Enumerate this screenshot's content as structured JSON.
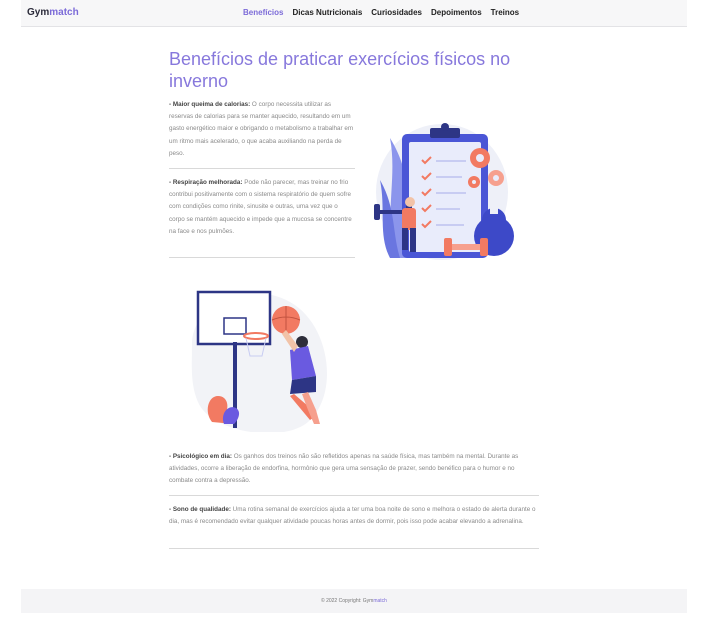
{
  "nav": {
    "brand_prefix": "Gym",
    "brand_suffix": "match",
    "links": [
      "Benefícios",
      "Dicas Nutricionais",
      "Curiosidades",
      "Depoimentos",
      "Treinos"
    ]
  },
  "main": {
    "title": "Benefícios de praticar exercícios físicos no inverno",
    "items": [
      {
        "label": "- Maior queima de calorias:",
        "text": " O corpo necessita utilizar as reservas de calorias para se manter aquecido, resultando em um gasto energético maior e obrigando o metabolismo a trabalhar em um ritmo mais acelerado, o que acaba auxiliando na perda de peso."
      },
      {
        "label": "- Respiração melhorada:",
        "text": " Pode não parecer, mas treinar no frio contribui positivamente com o sistema respiratório de quem sofre com condições como rinite, sinusite e outras, uma vez que o corpo se mantém aquecido e impede que a mucosa se concentre na face e nos pulmões."
      },
      {
        "label": "- Psicológico em dia:",
        "text": " Os ganhos dos treinos não são refletidos apenas na saúde física, mas também na mental. Durante as atividades, ocorre a liberação de endorfina, hormônio que gera uma sensação de prazer, sendo benéfico para o humor e no combate contra a depressão."
      },
      {
        "label": "- Sono de qualidade:",
        "text": " Uma rotina semanal de exercícios ajuda a ter uma boa noite de sono e melhora o estado de alerta durante o dia, mas é recomendado evitar qualquer atividade poucas horas antes de dormir, pois isso pode acabar elevando a adrenalina."
      }
    ]
  },
  "footer": {
    "text_prefix": "© 2022 Copyright: Gym",
    "text_suffix": "match"
  },
  "colors": {
    "accent": "#7c6bd8",
    "illustration_blue": "#4a56d6",
    "illustration_coral": "#f27a62"
  }
}
